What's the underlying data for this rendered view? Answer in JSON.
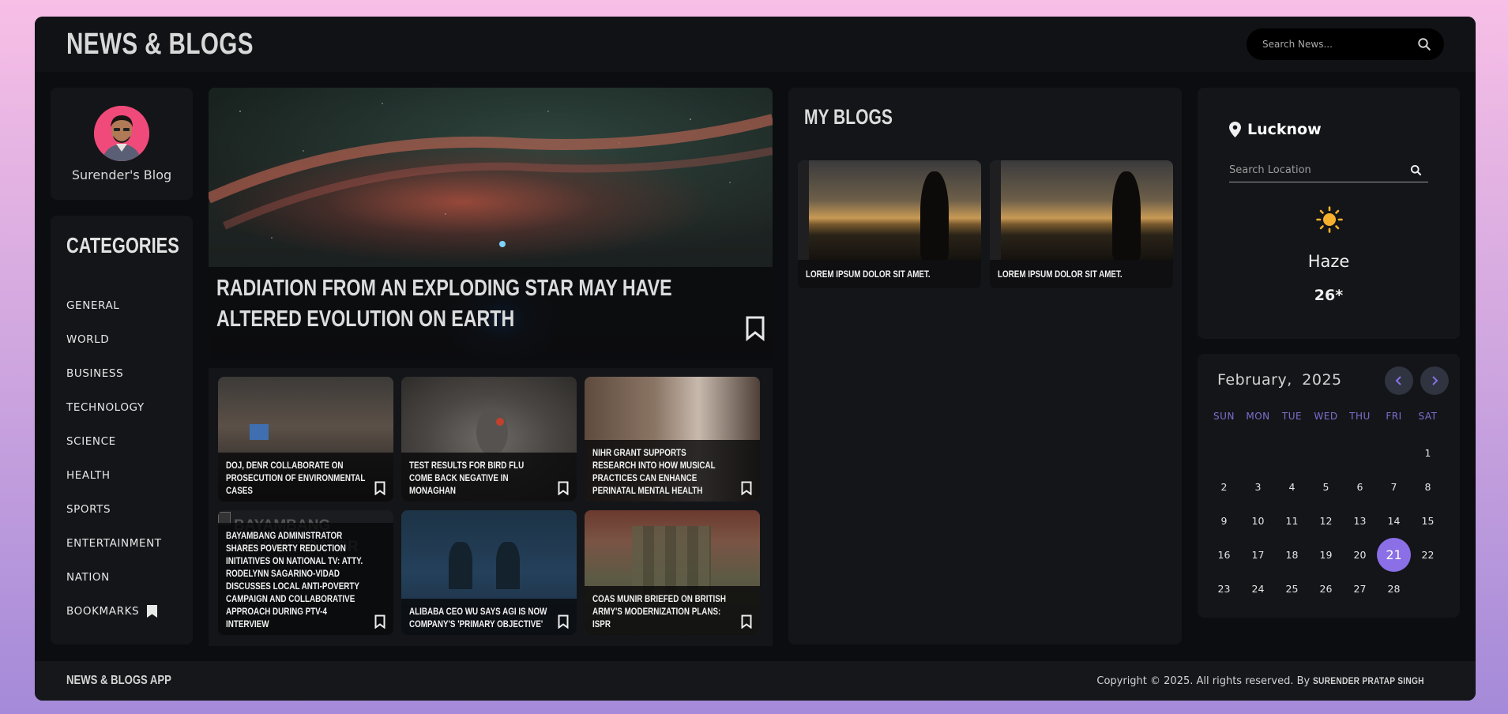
{
  "header": {
    "title": "NEWS & BLOGS",
    "search_placeholder": "Search News..."
  },
  "profile": {
    "name": "Surender's Blog"
  },
  "categories": {
    "title": "CATEGORIES",
    "items": [
      "GENERAL",
      "WORLD",
      "BUSINESS",
      "TECHNOLOGY",
      "SCIENCE",
      "HEALTH",
      "SPORTS",
      "ENTERTAINMENT",
      "NATION",
      "BOOKMARKS"
    ]
  },
  "hero": {
    "title": "RADIATION FROM AN EXPLODING STAR MAY HAVE ALTERED EVOLUTION ON EARTH"
  },
  "news": [
    {
      "title": "DOJ, DENR collaborate on prosecution of environmental cases"
    },
    {
      "title": "Test results for bird flu come back negative in Monaghan"
    },
    {
      "title": "NIHR grant supports research into how musical practices can enhance perinatal mental health"
    },
    {
      "title": "Bayambang administrator shares poverty reduction initiatives on National TV: Atty. Rodelynn Sagarino-Vidad discusses local anti-poverty campaign and collaborative approach during PTV-4 interview",
      "image_alt": "BAYAMBANG ADMINISTRATOR"
    },
    {
      "title": "Alibaba CEO Wu says AGI is now company's 'primary objective'"
    },
    {
      "title": "COAS Munir briefed on British Army's modernization plans: ISPR"
    }
  ],
  "blogs": {
    "title": "MY BLOGS",
    "items": [
      {
        "title": "LOREM IPSUM DOLOR SIT AMET."
      },
      {
        "title": "LOREM IPSUM DOLOR SIT AMET."
      }
    ]
  },
  "weather": {
    "location": "Lucknow",
    "search_placeholder": "Search Location",
    "description": "Haze",
    "temperature": "26*",
    "icon": "sun-icon",
    "sun_color": "#f6b02d"
  },
  "calendar": {
    "month": "February,",
    "year": "2025",
    "weekdays": [
      "SUN",
      "MON",
      "TUE",
      "WED",
      "THU",
      "FRI",
      "SAT"
    ],
    "first_weekday_index": 6,
    "days_in_month": 28,
    "today": 21,
    "accent": "#8a6fe6"
  },
  "footer": {
    "brand": "NEWS & BLOGS APP",
    "copyright": "Copyright © 2025. All rights reserved. By",
    "author": "SURENDER PRATAP SINGH"
  }
}
